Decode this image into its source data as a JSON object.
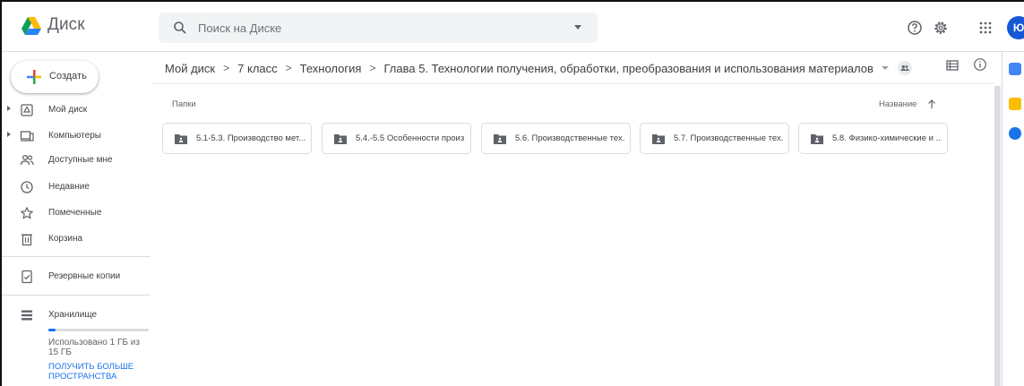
{
  "header": {
    "app_title": "Диск",
    "search_placeholder": "Поиск на Диске",
    "avatar_initial": "Ю",
    "icons": [
      "drive-logo-icon",
      "search-icon",
      "help-icon",
      "settings-icon",
      "apps-grid-icon"
    ]
  },
  "sidebar": {
    "create_label": "Создать",
    "items": [
      {
        "label": "Мой диск",
        "icon": "my-drive-icon",
        "expandable": true
      },
      {
        "label": "Компьютеры",
        "icon": "computer-icon",
        "expandable": true
      },
      {
        "label": "Доступные мне",
        "icon": "shared-people-icon",
        "expandable": false
      },
      {
        "label": "Недавние",
        "icon": "clock-icon",
        "expandable": false
      },
      {
        "label": "Помеченные",
        "icon": "star-icon",
        "expandable": false
      },
      {
        "label": "Корзина",
        "icon": "trash-icon",
        "expandable": false
      },
      {
        "label": "Резервные копии",
        "icon": "backup-icon",
        "expandable": false
      },
      {
        "label": "Хранилище",
        "icon": "storage-icon",
        "expandable": false
      }
    ],
    "storage": {
      "used_text": "Использовано 1 ГБ из 15 ГБ",
      "used_fraction": 0.067,
      "upgrade_link": "ПОЛУЧИТЬ БОЛЬШЕ ПРОСТРАНСТВА"
    }
  },
  "breadcrumb": {
    "items": [
      "Мой диск",
      "7 класс",
      "Технология",
      "Глава 5. Технологии получения, обработки, преобразования и использования материалов"
    ],
    "separator": ">"
  },
  "content": {
    "section_label": "Папки",
    "sort_label": "Название",
    "folders": [
      {
        "name": "5.1-5.3. Производство мет..."
      },
      {
        "name": "5.4.-5.5 Особенности произ..."
      },
      {
        "name": "5.6. Производственные тех..."
      },
      {
        "name": "5.7. Производственные тех..."
      },
      {
        "name": "5.8. Физико-химические и ..."
      }
    ]
  },
  "side_panel": {
    "icons": [
      "calendar-icon",
      "keep-icon",
      "tasks-icon"
    ]
  },
  "colors": {
    "accent_blue": "#1a73e8",
    "avatar_blue": "#1558d6",
    "divider": "#dadce0",
    "text_secondary": "#5f6368"
  }
}
